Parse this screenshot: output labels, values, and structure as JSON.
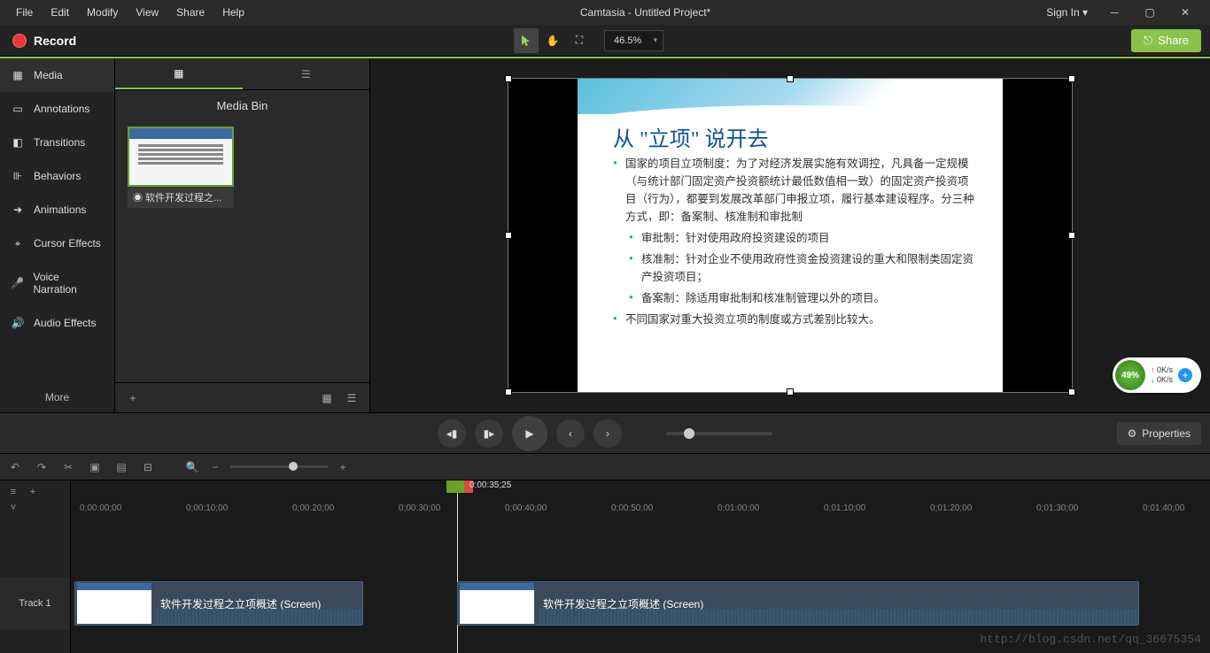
{
  "menu": {
    "items": [
      "File",
      "Edit",
      "Modify",
      "View",
      "Share",
      "Help"
    ],
    "title": "Camtasia - Untitled Project*",
    "signin": "Sign In ▾"
  },
  "toolbar": {
    "record": "Record",
    "zoom": "46.5%",
    "share": "Share"
  },
  "side": {
    "items": [
      "Media",
      "Annotations",
      "Transitions",
      "Behaviors",
      "Animations",
      "Cursor Effects",
      "Voice Narration",
      "Audio Effects"
    ],
    "more": "More"
  },
  "media": {
    "title": "Media Bin",
    "thumb": "◉ 软件开发过程之..."
  },
  "slide": {
    "title": "从 \"立项\" 说开去",
    "b1": "国家的项目立项制度：为了对经济发展实施有效调控，凡具备一定规模（与统计部门固定资产投资额统计最低数值相一致）的固定资产投资项目（行为），都要到发展改革部门申报立项，履行基本建设程序。分三种方式，即：备案制、核准制和审批制",
    "b2": "审批制：针对使用政府投资建设的项目",
    "b3": "核准制：针对企业不使用政府性资金投资建设的重大和限制类固定资产投资项目；",
    "b4": "备案制：除适用审批制和核准制管理以外的项目。",
    "b5": "不同国家对重大投资立项的制度或方式差别比较大。"
  },
  "props": "Properties",
  "timeline": {
    "time": "0:00:35;25",
    "ticks": [
      "0;00:00;00",
      "0;00:10;00",
      "0;00:20;00",
      "0;00:30;00",
      "0;00:40;00",
      "0;00:50;00",
      "0;01:00;00",
      "0;01:10;00",
      "0;01:20;00",
      "0;01:30;00",
      "0;01:40;00"
    ],
    "track": "Track 1",
    "clip": "软件开发过程之立项概述 (Screen)"
  },
  "net": {
    "pct": "49%",
    "up": "0K/s",
    "down": "0K/s"
  },
  "watermark": "http://blog.csdn.net/qq_36675354"
}
